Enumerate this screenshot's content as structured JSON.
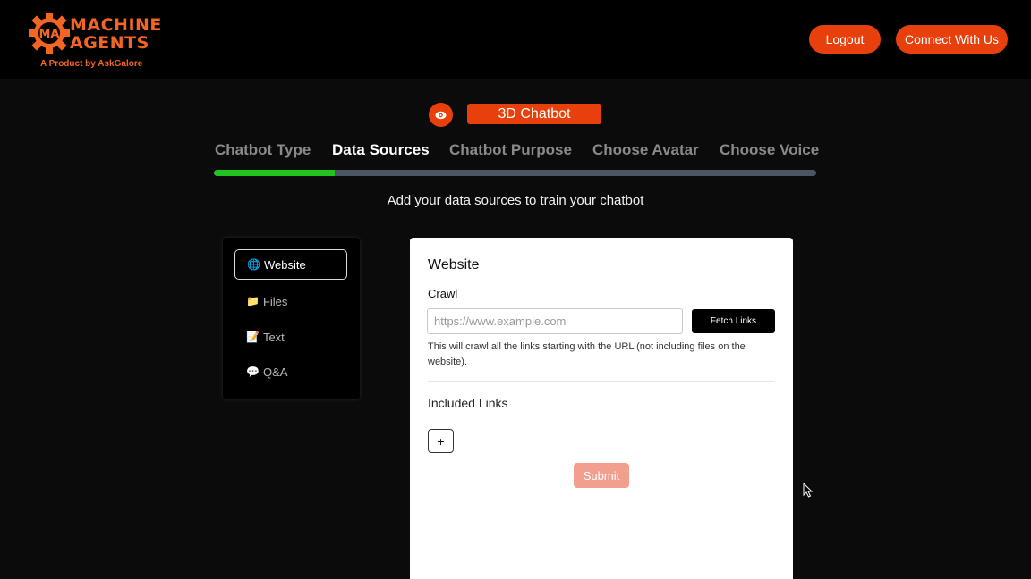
{
  "brand": {
    "line1": "MACHINE",
    "line2": "AGENTS",
    "tagline": "A Product by AskGalore",
    "badge": "MA",
    "color": "#f26522"
  },
  "header": {
    "logout_label": "Logout",
    "connect_label": "Connect With Us"
  },
  "chatbot_type": {
    "icon": "eye-icon",
    "label": "3D Chatbot"
  },
  "steps": [
    {
      "label": "Chatbot Type",
      "active": false
    },
    {
      "label": "Data Sources",
      "active": true
    },
    {
      "label": "Chatbot Purpose",
      "active": false
    },
    {
      "label": "Choose Avatar",
      "active": false
    },
    {
      "label": "Choose Voice",
      "active": false
    }
  ],
  "progress": {
    "fraction": 0.2,
    "fill_color": "#22c21f"
  },
  "subtitle": "Add your data sources to train your chatbot",
  "sources": [
    {
      "icon": "🌐",
      "label": "Website",
      "active": true
    },
    {
      "icon": "📁",
      "label": "Files",
      "active": false
    },
    {
      "icon": "📝",
      "label": "Text",
      "active": false
    },
    {
      "icon": "💬",
      "label": "Q&A",
      "active": false
    }
  ],
  "panel": {
    "title": "Website",
    "crawl_label": "Crawl",
    "url_placeholder": "https://www.example.com",
    "url_value": "",
    "fetch_label": "Fetch Links",
    "hint": "This will crawl all the links starting with the URL (not including files on the website).",
    "included_label": "Included Links",
    "add_label": "+",
    "submit_label": "Submit"
  },
  "colors": {
    "accent": "#e8400c",
    "submit_disabled": "#f2a08d"
  }
}
